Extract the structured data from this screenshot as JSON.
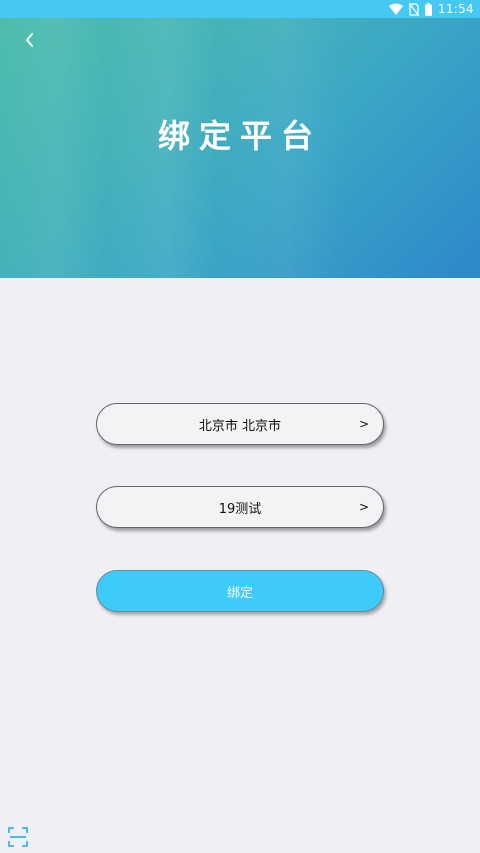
{
  "status_bar": {
    "time": "11:54",
    "icons": [
      "wifi-icon",
      "no-sim-icon",
      "battery-icon"
    ]
  },
  "header": {
    "title": "绑定平台",
    "back_icon": "chevron-left-icon"
  },
  "form": {
    "city_value": "北京市 北京市",
    "platform_value": "19测试",
    "row_arrow": ">",
    "bind_label": "绑定"
  },
  "footer": {
    "scan_icon": "scan-icon"
  },
  "colors": {
    "status_bar": "#45c8f1",
    "header_start": "#4dbdac",
    "header_end": "#2d88c9",
    "background": "#efeff5",
    "button": "#3dcbfa"
  }
}
